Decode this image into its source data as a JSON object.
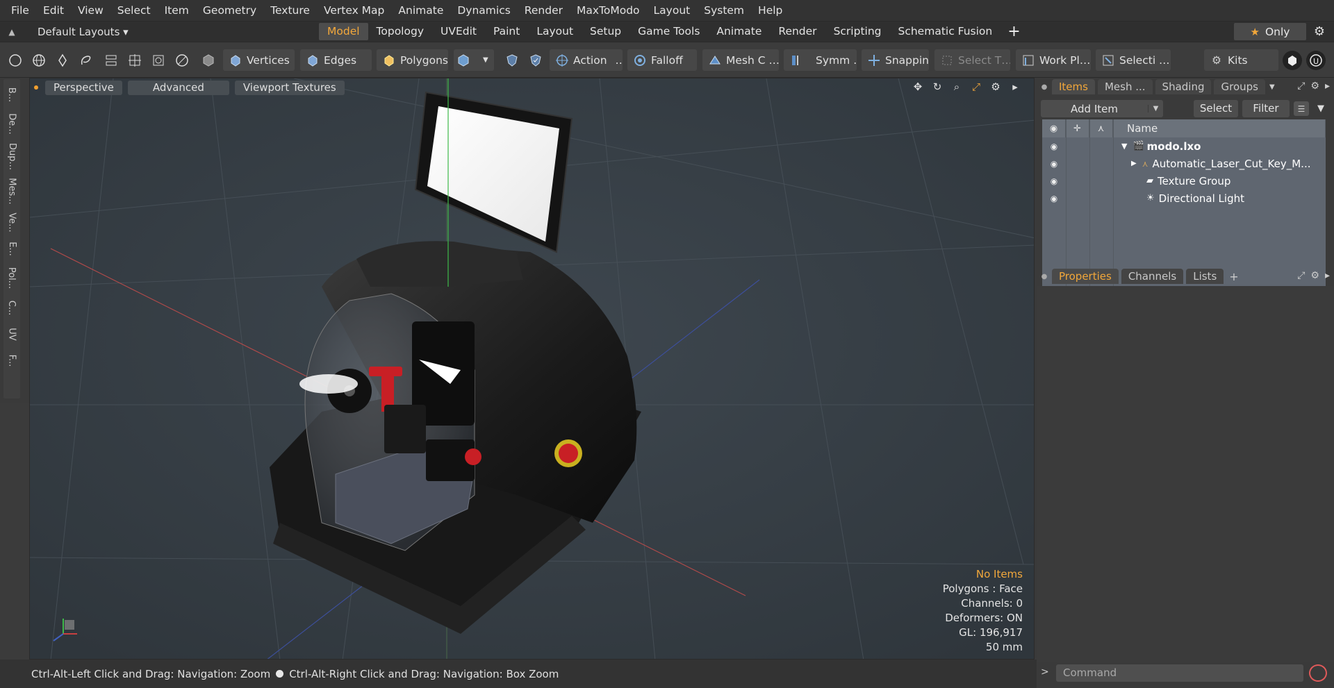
{
  "menu": [
    "File",
    "Edit",
    "View",
    "Select",
    "Item",
    "Geometry",
    "Texture",
    "Vertex Map",
    "Animate",
    "Dynamics",
    "Render",
    "MaxToModo",
    "Layout",
    "System",
    "Help"
  ],
  "layout_select": "Default Layouts ▾",
  "tabs": [
    "Model",
    "Topology",
    "UVEdit",
    "Paint",
    "Layout",
    "Setup",
    "Game Tools",
    "Animate",
    "Render",
    "Scripting",
    "Schematic Fusion"
  ],
  "active_tab": "Model",
  "only_label": "Only",
  "toolbar": {
    "vertices": "Vertices",
    "edges": "Edges",
    "polygons": "Polygons",
    "action": "Action",
    "action_more": "…",
    "falloff": "Falloff",
    "mesh": "Mesh C …",
    "symmetry": "Symm …",
    "snapping": "Snapping",
    "select_t": "Select T…",
    "work_plane": "Work Pl…",
    "selecti": "Selecti …",
    "kits": "Kits"
  },
  "left_strip": [
    "B...",
    "De...",
    "Dup...",
    "Mes...",
    "Ve...",
    "E...",
    "Pol...",
    "C...",
    "UV",
    "F..."
  ],
  "viewport": {
    "perspective": "Perspective",
    "advanced": "Advanced",
    "textures": "Viewport Textures",
    "info": {
      "no_items": "No Items",
      "polygons": "Polygons : Face",
      "channels": "Channels: 0",
      "deformers": "Deformers: ON",
      "gl": "GL: 196,917",
      "scale": "50 mm"
    }
  },
  "status": {
    "left": "Ctrl-Alt-Left Click and Drag: Navigation: Zoom",
    "right": "Ctrl-Alt-Right Click and Drag: Navigation: Box Zoom"
  },
  "right_panel": {
    "tabs": [
      "Items",
      "Mesh ...",
      "Shading",
      "Groups"
    ],
    "add_item": "Add Item",
    "select": "Select",
    "filter": "Filter",
    "name_header": "Name",
    "items": [
      {
        "label": "modo.lxo",
        "bold": true
      },
      {
        "label": "Automatic_Laser_Cut_Key_M...",
        "bold": false
      },
      {
        "label": "Texture Group",
        "bold": false
      },
      {
        "label": "Directional Light",
        "bold": false
      }
    ],
    "props_tabs": [
      "Properties",
      "Channels",
      "Lists"
    ],
    "command_placeholder": "Command"
  }
}
